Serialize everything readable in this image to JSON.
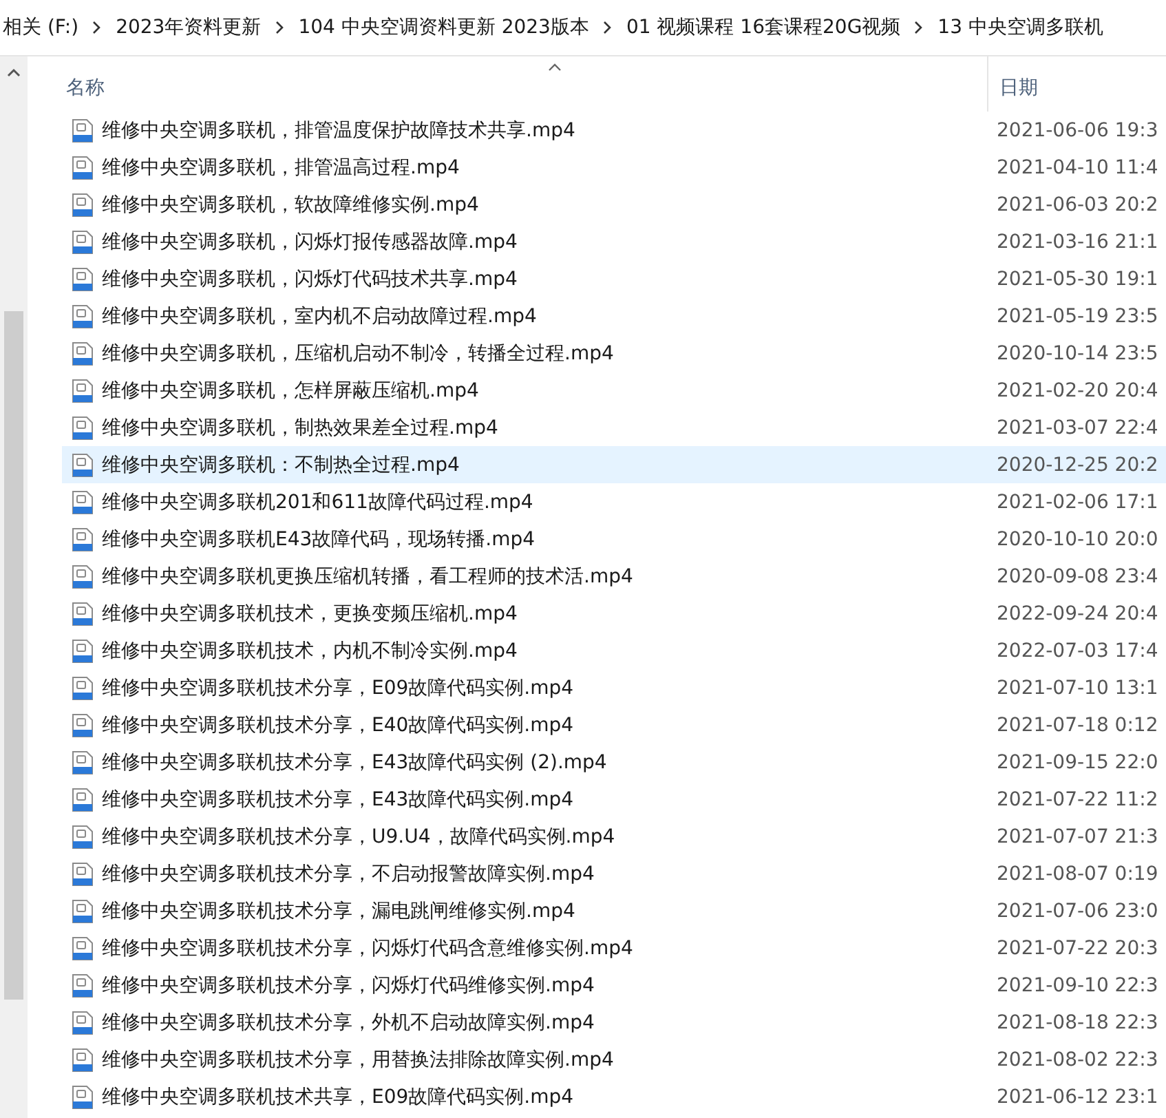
{
  "breadcrumb": [
    "相关 (F:)",
    "2023年资料更新",
    "104 中央空调资料更新 2023版本",
    "01 视频课程 16套课程20G视频",
    "13 中央空调多联机"
  ],
  "columns": [
    "名称",
    "日期"
  ],
  "files": [
    {
      "name": "维修中央空调多联机，排管温度保护故障技术共享.mp4",
      "date": "2021-06-06 19:3",
      "selected": false
    },
    {
      "name": "维修中央空调多联机，排管温高过程.mp4",
      "date": "2021-04-10 11:4",
      "selected": false
    },
    {
      "name": "维修中央空调多联机，软故障维修实例.mp4",
      "date": "2021-06-03 20:2",
      "selected": false
    },
    {
      "name": "维修中央空调多联机，闪烁灯报传感器故障.mp4",
      "date": "2021-03-16 21:1",
      "selected": false
    },
    {
      "name": "维修中央空调多联机，闪烁灯代码技术共享.mp4",
      "date": "2021-05-30 19:1",
      "selected": false
    },
    {
      "name": "维修中央空调多联机，室内机不启动故障过程.mp4",
      "date": "2021-05-19 23:5",
      "selected": false
    },
    {
      "name": "维修中央空调多联机，压缩机启动不制冷，转播全过程.mp4",
      "date": "2020-10-14 23:5",
      "selected": false
    },
    {
      "name": "维修中央空调多联机，怎样屏蔽压缩机.mp4",
      "date": "2021-02-20 20:4",
      "selected": false
    },
    {
      "name": "维修中央空调多联机，制热效果差全过程.mp4",
      "date": "2021-03-07 22:4",
      "selected": false
    },
    {
      "name": "维修中央空调多联机：不制热全过程.mp4",
      "date": "2020-12-25 20:2",
      "selected": true
    },
    {
      "name": "维修中央空调多联机201和611故障代码过程.mp4",
      "date": "2021-02-06 17:1",
      "selected": false
    },
    {
      "name": "维修中央空调多联机E43故障代码，现场转播.mp4",
      "date": "2020-10-10 20:0",
      "selected": false
    },
    {
      "name": "维修中央空调多联机更换压缩机转播，看工程师的技术活.mp4",
      "date": "2020-09-08 23:4",
      "selected": false
    },
    {
      "name": "维修中央空调多联机技术，更换变频压缩机.mp4",
      "date": "2022-09-24 20:4",
      "selected": false
    },
    {
      "name": "维修中央空调多联机技术，内机不制冷实例.mp4",
      "date": "2022-07-03 17:4",
      "selected": false
    },
    {
      "name": "维修中央空调多联机技术分享，E09故障代码实例.mp4",
      "date": "2021-07-10 13:1",
      "selected": false
    },
    {
      "name": "维修中央空调多联机技术分享，E40故障代码实例.mp4",
      "date": "2021-07-18 0:12",
      "selected": false
    },
    {
      "name": "维修中央空调多联机技术分享，E43故障代码实例 (2).mp4",
      "date": "2021-09-15 22:0",
      "selected": false
    },
    {
      "name": "维修中央空调多联机技术分享，E43故障代码实例.mp4",
      "date": "2021-07-22 11:2",
      "selected": false
    },
    {
      "name": "维修中央空调多联机技术分享，U9.U4，故障代码实例.mp4",
      "date": "2021-07-07 21:3",
      "selected": false
    },
    {
      "name": "维修中央空调多联机技术分享，不启动报警故障实例.mp4",
      "date": "2021-08-07 0:19",
      "selected": false
    },
    {
      "name": "维修中央空调多联机技术分享，漏电跳闸维修实例.mp4",
      "date": "2021-07-06 23:0",
      "selected": false
    },
    {
      "name": "维修中央空调多联机技术分享，闪烁灯代码含意维修实例.mp4",
      "date": "2021-07-22 20:3",
      "selected": false
    },
    {
      "name": "维修中央空调多联机技术分享，闪烁灯代码维修实例.mp4",
      "date": "2021-09-10 22:3",
      "selected": false
    },
    {
      "name": "维修中央空调多联机技术分享，外机不启动故障实例.mp4",
      "date": "2021-08-18 22:3",
      "selected": false
    },
    {
      "name": "维修中央空调多联机技术分享，用替换法排除故障实例.mp4",
      "date": "2021-08-02 22:3",
      "selected": false
    },
    {
      "name": "维修中央空调多联机技术共享，E09故障代码实例.mp4",
      "date": "2021-06-12 23:1",
      "selected": false
    }
  ]
}
